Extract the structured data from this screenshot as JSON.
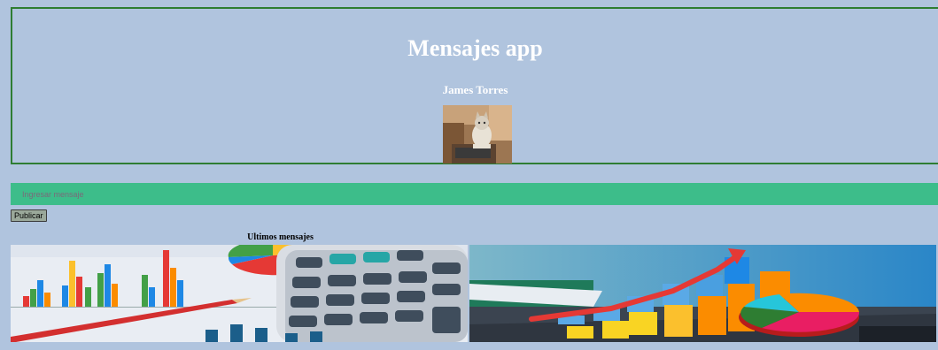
{
  "header": {
    "title": "Mensajes app",
    "user_name": "James Torres",
    "avatar_icon": "cat-at-laptop-photo"
  },
  "composer": {
    "placeholder": "Ingresar mensaje",
    "publish_label": "Publicar"
  },
  "feed": {
    "heading": "Ultimos mensajes",
    "images": [
      {
        "icon": "financial-charts-calculator-photo"
      },
      {
        "icon": "growth-bar-chart-photo"
      }
    ]
  },
  "colors": {
    "background": "#b0c4de",
    "header_border": "#2e7d32",
    "input_background": "#3dbd8a"
  }
}
